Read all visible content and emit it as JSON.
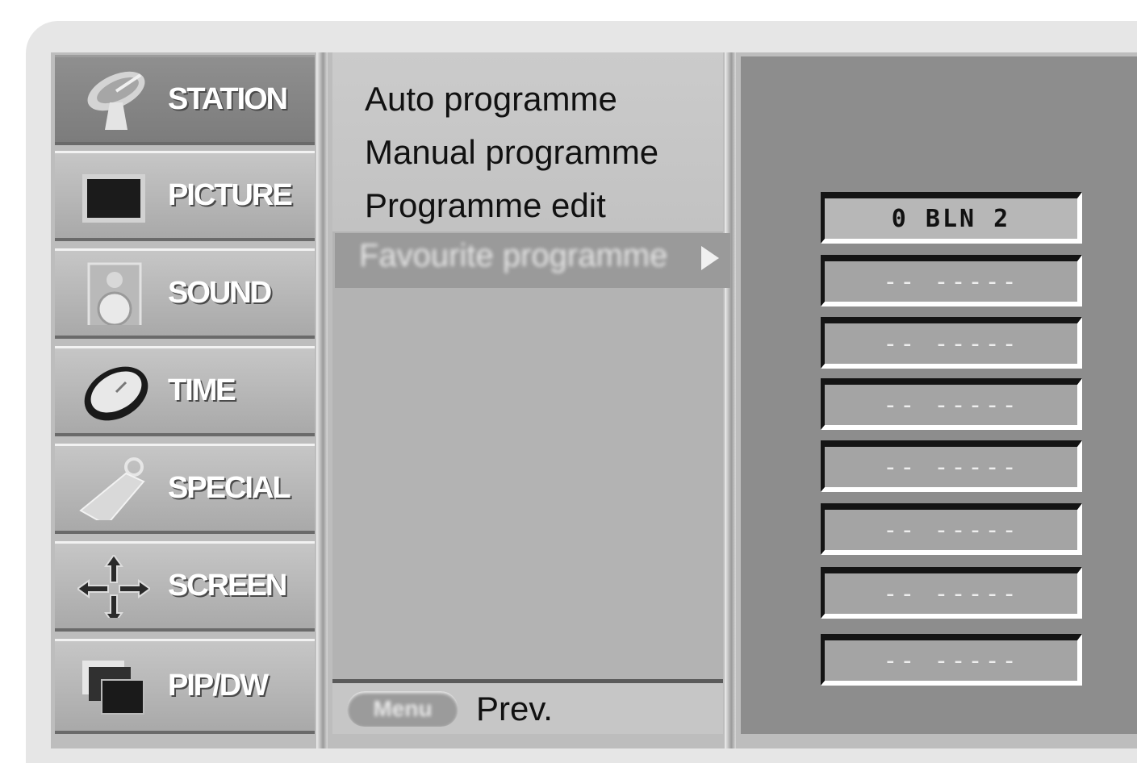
{
  "categories": [
    {
      "label": "STATION",
      "icon": "satellite-dish-icon",
      "active": true
    },
    {
      "label": "PICTURE",
      "icon": "tv-screen-icon"
    },
    {
      "label": "SOUND",
      "icon": "speaker-icon"
    },
    {
      "label": "TIME",
      "icon": "clock-icon"
    },
    {
      "label": "SPECIAL",
      "icon": "key-tag-icon"
    },
    {
      "label": "SCREEN",
      "icon": "move-arrows-icon"
    },
    {
      "label": "PIP/DW",
      "icon": "pip-windows-icon"
    }
  ],
  "submenu": {
    "items": [
      "Auto programme",
      "Manual programme",
      "Programme edit"
    ],
    "highlighted": "Favourite programme"
  },
  "footer": {
    "menu_button": "Menu",
    "prev_label": "Prev."
  },
  "favourites": [
    "0 BLN 2",
    "-- -----",
    "-- -----",
    "-- -----",
    "-- -----",
    "-- -----",
    "-- -----",
    "-- -----"
  ]
}
